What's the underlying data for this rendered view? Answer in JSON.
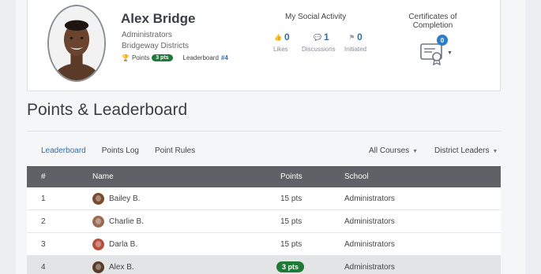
{
  "profile": {
    "name": "Alex Bridge",
    "org": "Administrators",
    "district": "Bridgeway Districts",
    "points_label": "Points",
    "points_value": "3 pts",
    "leaderboard_label": "Leaderboard",
    "leaderboard_rank": "#4"
  },
  "social": {
    "title": "My Social Activity",
    "stats": [
      {
        "value": "0",
        "label": "Likes",
        "icon": "thumbs-up-icon"
      },
      {
        "value": "1",
        "label": "Discussions",
        "icon": "chat-icon"
      },
      {
        "value": "0",
        "label": "Initiated",
        "icon": "flag-icon"
      }
    ]
  },
  "certificates": {
    "title": "Certificates of Completion",
    "count": "0"
  },
  "section": {
    "title": "Points & Leaderboard"
  },
  "tabs": [
    {
      "label": "Leaderboard",
      "active": true
    },
    {
      "label": "Points Log",
      "active": false
    },
    {
      "label": "Point Rules",
      "active": false
    }
  ],
  "filters": {
    "courses": "All Courses",
    "leaders": "District Leaders"
  },
  "table": {
    "headers": {
      "rank": "#",
      "name": "Name",
      "points": "Points",
      "school": "School"
    },
    "rows": [
      {
        "rank": "1",
        "name": "Bailey B.",
        "points": "15 pts",
        "school": "Administrators",
        "avatar_color": "#7a4a2e"
      },
      {
        "rank": "2",
        "name": "Charlie B.",
        "points": "15 pts",
        "school": "Administrators",
        "avatar_color": "#9a6b52"
      },
      {
        "rank": "3",
        "name": "Darla B.",
        "points": "15 pts",
        "school": "Administrators",
        "avatar_color": "#b5503c"
      },
      {
        "rank": "4",
        "name": "Alex B.",
        "points": "3 pts",
        "school": "Administrators",
        "avatar_color": "#5a3a28",
        "highlight": true
      }
    ]
  },
  "colors": {
    "accent": "#2a6fb0",
    "points_pill": "#1f7a3a",
    "table_header": "#5e6166"
  }
}
